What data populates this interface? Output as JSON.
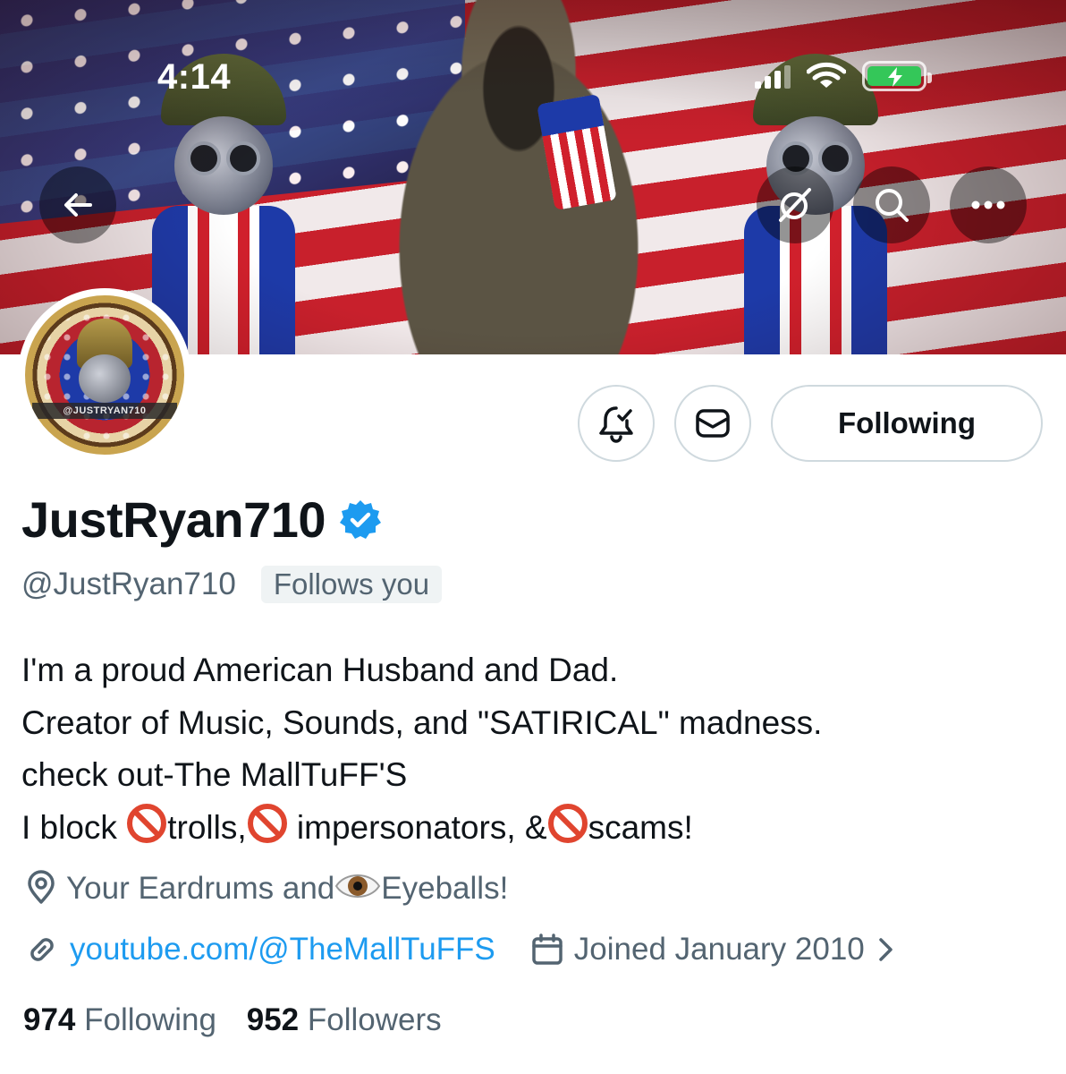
{
  "status_bar": {
    "time": "4:14"
  },
  "banner": {
    "back_icon": "arrow-left-icon",
    "grok_icon": "grok-icon",
    "search_icon": "search-icon",
    "more_icon": "more-horizontal-icon"
  },
  "profile": {
    "avatar_text": "@JUSTRYAN710",
    "display_name": "JustRyan710",
    "verified": true,
    "handle": "@JustRyan710",
    "follows_you": "Follows you",
    "bio": {
      "line1": "I'm a proud American Husband and Dad.",
      "line2": "Creator of Music, Sounds, and \"SATIRICAL\" madness.",
      "line3": "check out-The MallTuFF'S",
      "line4_a": "I block ",
      "line4_b": "trolls,",
      "line4_c": " impersonators, &",
      "line4_d": "scams!"
    },
    "location_a": "Your Eardrums and",
    "location_b": "Eyeballs!",
    "website": "youtube.com/@TheMallTuFFS",
    "joined": "Joined January 2010",
    "following_count": "974",
    "following_label": "Following",
    "followers_count": "952",
    "followers_label": "Followers"
  },
  "actions": {
    "following_button": "Following"
  },
  "colors": {
    "link": "#1d9bf0",
    "verified": "#1d9bf0",
    "secondary_text": "#536471",
    "primary_text": "#0f1419"
  }
}
